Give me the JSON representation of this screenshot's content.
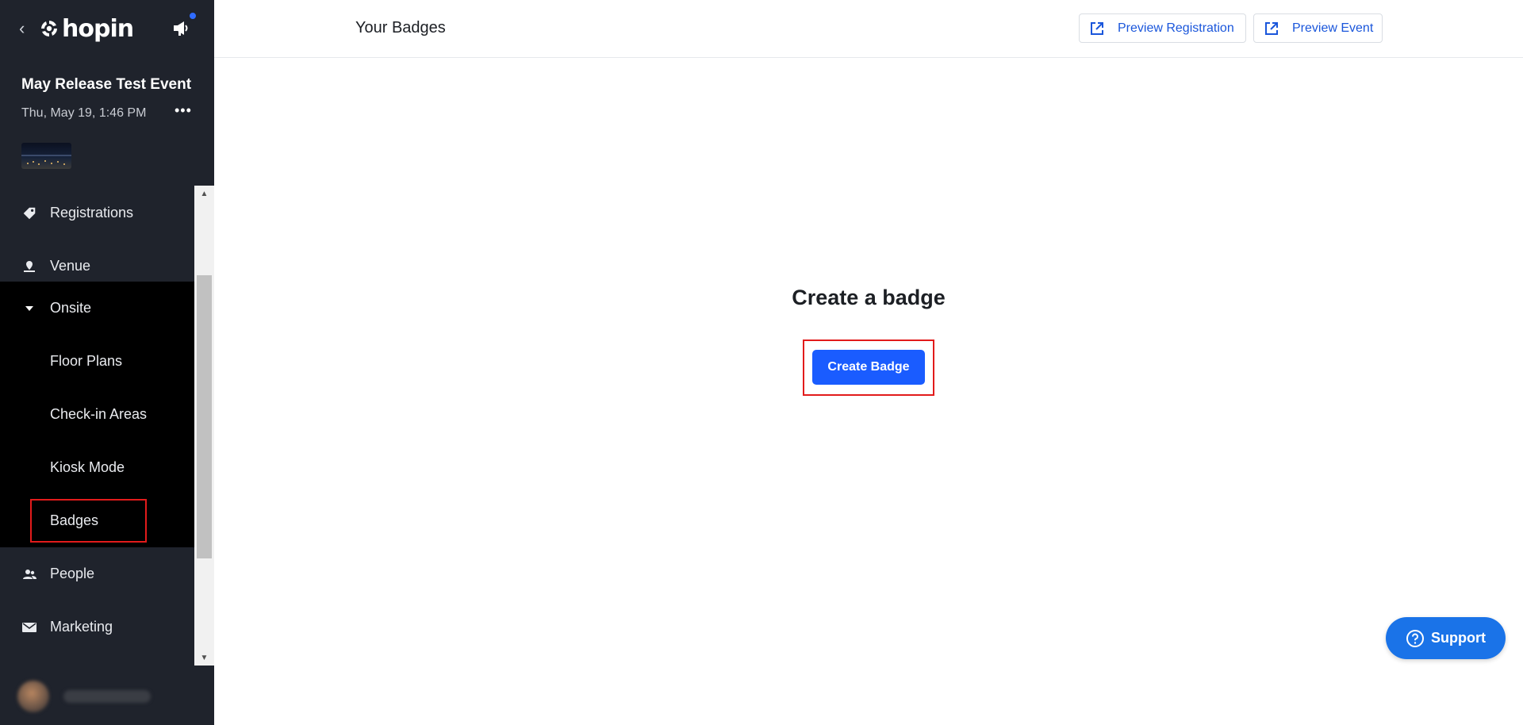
{
  "sidebar": {
    "logo_text": "hopin",
    "event": {
      "title": "May Release Test Event",
      "date": "Thu, May 19, 1:46 PM",
      "more_label": "•••"
    },
    "nav": {
      "registrations": "Registrations",
      "venue": "Venue",
      "onsite": "Onsite",
      "floor_plans": "Floor Plans",
      "check_in_areas": "Check-in Areas",
      "kiosk_mode": "Kiosk Mode",
      "badges": "Badges",
      "people": "People",
      "marketing": "Marketing"
    }
  },
  "topbar": {
    "title": "Your Badges",
    "preview_registration": "Preview Registration",
    "preview_event": "Preview Event"
  },
  "main": {
    "heading": "Create a badge",
    "create_button": "Create Badge"
  },
  "support": {
    "label": "Support"
  },
  "colors": {
    "sidebar_bg": "#1f232c",
    "onsite_bg": "#000000",
    "primary": "#1a5cff",
    "link": "#1a56db",
    "highlight": "#e21b1b",
    "support": "#1a73e8"
  }
}
